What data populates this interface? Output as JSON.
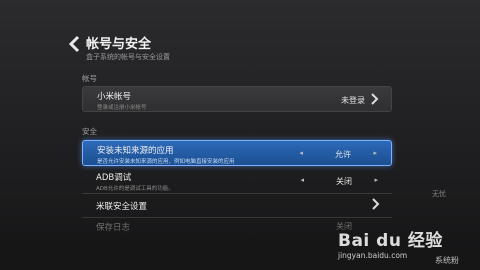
{
  "header": {
    "title": "帐号与安全",
    "subtitle": "盒子系统的帐号与安全设置"
  },
  "sections": {
    "account": "帐号",
    "security": "安全"
  },
  "account_item": {
    "label": "小米帐号",
    "desc": "登录或注册小米帐号",
    "value": "未登录"
  },
  "security_items": [
    {
      "label": "安装未知来源的应用",
      "desc": "是否允许安装未知来源的应用，例如电脑直接安装的应用",
      "value": "允许",
      "selected": true
    },
    {
      "label": "ADB调试",
      "desc": "ADB允许的是调试工具的功能。",
      "value": "关闭"
    },
    {
      "label": "米联安全设置",
      "desc": "",
      "value": ""
    },
    {
      "label": "保存日志",
      "desc": "",
      "value": "关闭"
    }
  ],
  "watermark": {
    "brand": "Bai du 经验",
    "url": "jingyan.baidu.com",
    "corner": "系统粉",
    "faint": "无忧"
  }
}
